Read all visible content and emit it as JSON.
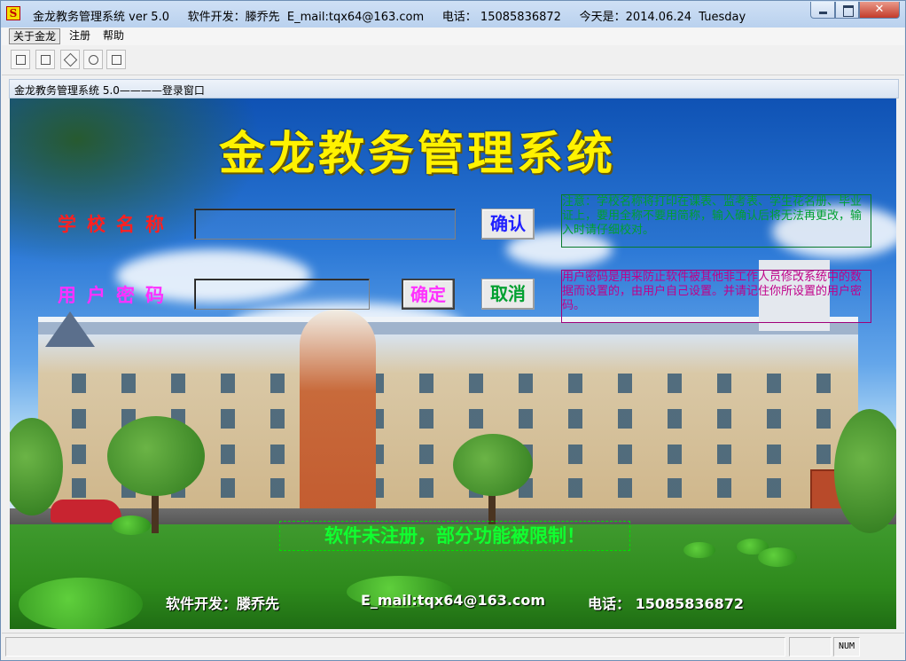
{
  "window": {
    "title": "金龙教务管理系统 ver 5.0     软件开发：滕乔先  E_mail:tqx64@163.com     电话： 15085836872     今天是：2014.06.24  Tuesday",
    "close_glyph": "✕"
  },
  "menu": {
    "about": "关于金龙",
    "register": "注册",
    "help": "帮助"
  },
  "toolbar": {
    "icons": [
      "list-icon",
      "form-icon",
      "tools-icon",
      "settings-icon",
      "report-icon"
    ]
  },
  "child_window": {
    "title": "金龙教务管理系统 5.0————登录窗口"
  },
  "login": {
    "headline": "金龙教务管理系统",
    "school_label": "学校名称",
    "school_value": "",
    "school_confirm": "确认",
    "pwd_label": "用户密码",
    "pwd_value": "",
    "pwd_confirm": "确定",
    "pwd_cancel": "取消",
    "school_note": "注意：学校名称将打印在课表、监考表、学生花名册、毕业证上，要用全称不要用简称，输入确认后将无法再更改，输入时请仔细校对。",
    "pwd_note": "用户密码是用来防止软件被其他非工作人员修改系统中的数据而设置的，由用户自己设置。并请记住你所设置的用户密码。",
    "unregistered_banner": "软件未注册，部分功能被限制！"
  },
  "footer": {
    "developer": "软件开发：滕乔先",
    "email": "E_mail:tqx64@163.com",
    "phone": "电话：  15085836872"
  },
  "status": {
    "num": "NUM"
  },
  "colors": {
    "headline": "#fff200",
    "school_label": "#ff2020",
    "pwd_label": "#ff30ff",
    "note_school": "#00a030",
    "note_pwd": "#c0008a",
    "banner": "#10ff30"
  }
}
